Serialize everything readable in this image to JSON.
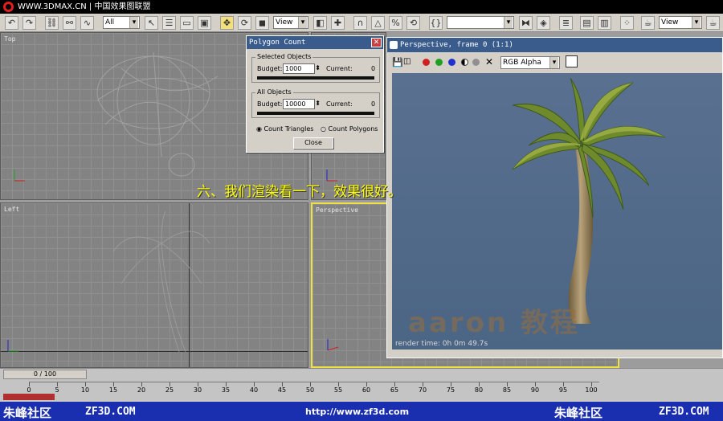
{
  "titlebar": {
    "text": "WWW.3DMAX.CN | 中国效果图联盟"
  },
  "toolbar": {
    "select_filter": "All",
    "view_left": "View",
    "view_right": "View",
    "named_sel": ""
  },
  "viewports": {
    "top_label": "Top",
    "left_label": "Left",
    "persp_label": "Perspective"
  },
  "polygon_dialog": {
    "title": "Polygon Count",
    "selected_caption": "Selected Objects",
    "all_caption": "All Objects",
    "budget_label": "Budget:",
    "current_label": "Current:",
    "selected_budget": "1000",
    "selected_current": "0",
    "all_budget": "10000",
    "all_current": "0",
    "radio_triangles": "Count Triangles",
    "radio_polygons": "Count Polygons",
    "close": "Close"
  },
  "render_window": {
    "title": "Perspective, frame 0 (1:1)",
    "channel": "RGB Alpha",
    "render_time": "render time: 0h 0m 49.7s",
    "watermark": "aaron  教程"
  },
  "caption": "六、我们渲染看一下，效果很好。",
  "timeline": {
    "slider_label": "0 / 100",
    "ticks": [
      "0",
      "5",
      "10",
      "15",
      "20",
      "25",
      "30",
      "35",
      "40",
      "45",
      "50",
      "55",
      "60",
      "65",
      "70",
      "75",
      "80",
      "85",
      "90",
      "95",
      "100"
    ]
  },
  "footer": {
    "left": "朱峰社区",
    "left_url": "ZF3D.COM",
    "center": "http://www.zf3d.com",
    "right": "朱峰社区",
    "right_url": "ZF3D.COM"
  },
  "colors": {
    "title_bar": "#3a5c8c",
    "caption": "#ffff00",
    "footer": "#1a2eb0"
  }
}
